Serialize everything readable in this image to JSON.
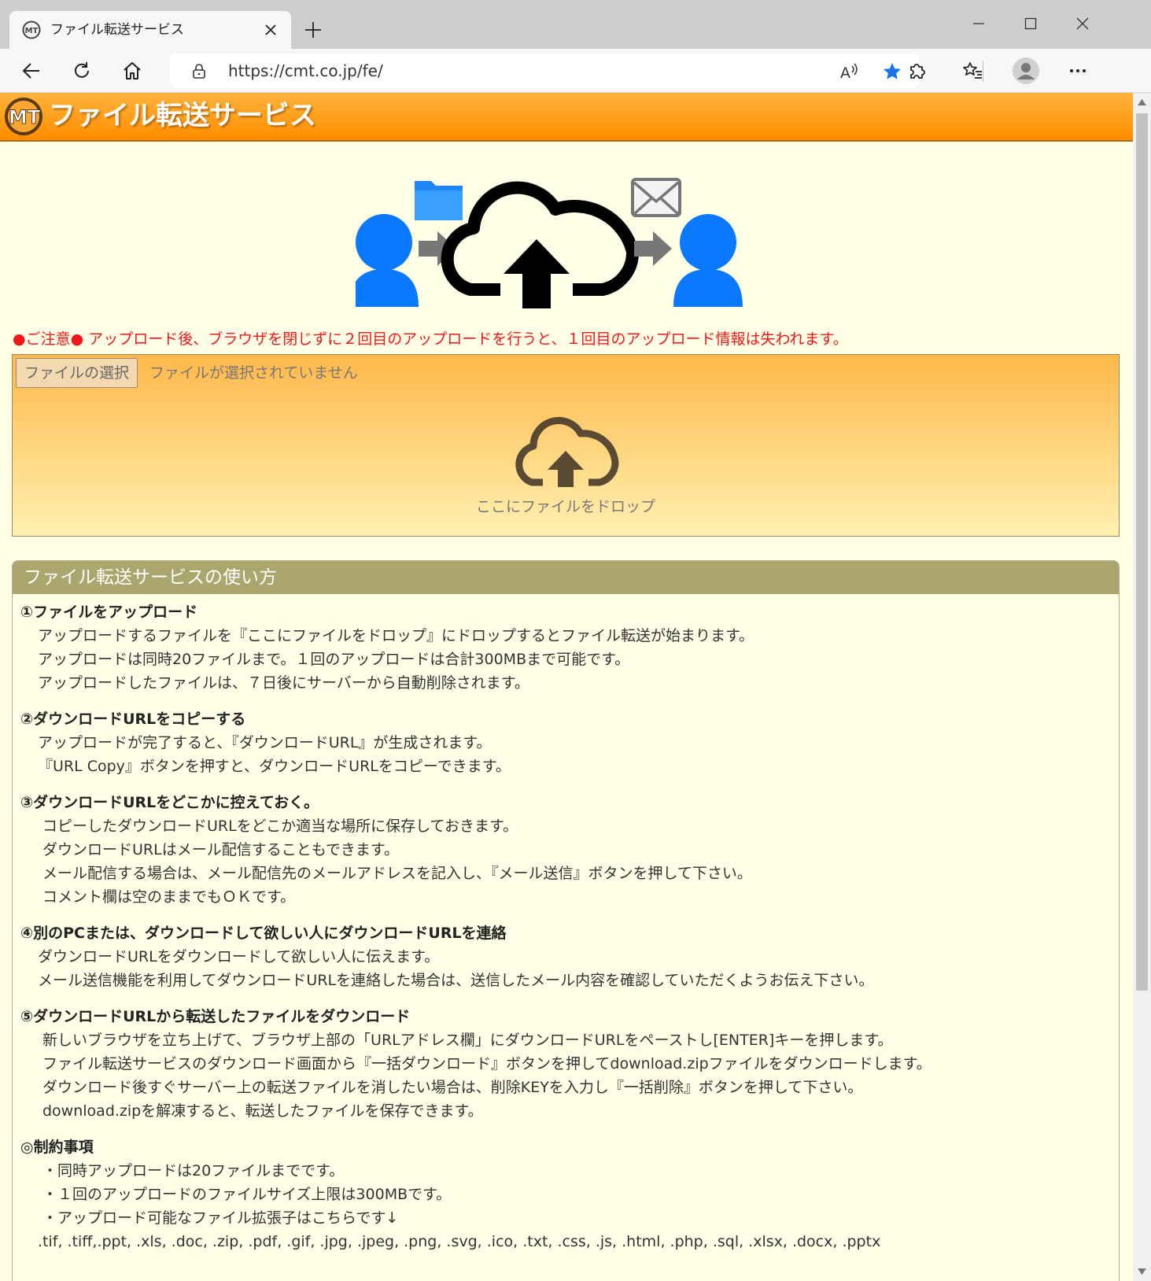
{
  "browser": {
    "tab_title": "ファイル転送サービス",
    "url": "https://cmt.co.jp/fe/"
  },
  "colors": {
    "header_orange": "#ff8c00",
    "page_background": "#ffffe8",
    "notice_red": "#f01818",
    "section_header": "#aaa66e",
    "person_blue": "#0a78ff"
  },
  "icons": [
    "cmt-logo-icon",
    "close-icon",
    "plus-icon",
    "minimize-icon",
    "maximize-icon",
    "back-icon",
    "refresh-icon",
    "home-icon",
    "lock-icon",
    "read-aloud-icon",
    "star-icon",
    "extensions-icon",
    "favorites-icon",
    "profile-icon",
    "more-icon",
    "cloud-upload-icon",
    "folder-icon",
    "mail-icon",
    "person-icon"
  ],
  "site": {
    "title": "ファイル転送サービス"
  },
  "notice": "●ご注意● アップロード後、ブラウザを閉じずに２回目のアップロードを行うと、１回目のアップロード情報は失われます。",
  "upload": {
    "button_label": "ファイルの選択",
    "status": "ファイルが選択されていません",
    "drop_label": "ここにファイルをドロップ"
  },
  "howto": {
    "title": "ファイル転送サービスの使い方",
    "steps": [
      {
        "title": "①ファイルをアップロード",
        "lines": [
          "アップロードするファイルを『ここにファイルをドロップ』にドロップするとファイル転送が始まります。",
          "アップロードは同時20ファイルまで。１回のアップロードは合計300MBまで可能です。",
          "アップロードしたファイルは、７日後にサーバーから自動削除されます。"
        ]
      },
      {
        "title": "②ダウンロードURLをコピーする",
        "lines": [
          "アップロードが完了すると、『ダウンロードURL』が生成されます。",
          "『URL Copy』ボタンを押すと、ダウンロードURLをコピーできます。"
        ]
      },
      {
        "title": "③ダウンロードURLをどこかに控えておく。",
        "lines": [
          "コピーしたダウンロードURLをどこか適当な場所に保存しておきます。",
          "ダウンロードURLはメール配信することもできます。",
          "メール配信する場合は、メール配信先のメールアドレスを記入し、『メール送信』ボタンを押して下さい。",
          "コメント欄は空のままでもＯＫです。"
        ]
      },
      {
        "title": "④別のPCまたは、ダウンロードして欲しい人にダウンロードURLを連絡",
        "lines": [
          "ダウンロードURLをダウンロードして欲しい人に伝えます。",
          "メール送信機能を利用してダウンロードURLを連絡した場合は、送信したメール内容を確認していただくようお伝え下さい。"
        ]
      },
      {
        "title": "⑤ダウンロードURLから転送したファイルをダウンロード",
        "lines": [
          "新しいブラウザを立ち上げて、ブラウザ上部の「URLアドレス欄」にダウンロードURLをペーストし[ENTER]キーを押します。",
          "ファイル転送サービスのダウンロード画面から『一括ダウンロード』ボタンを押してdownload.zipファイルをダウンロードします。",
          "ダウンロード後すぐサーバー上の転送ファイルを消したい場合は、削除KEYを入力し『一括削除』ボタンを押して下さい。",
          "download.zipを解凍すると、転送したファイルを保存できます。"
        ]
      }
    ],
    "restrictions": {
      "title": "◎制約事項",
      "lines": [
        "・同時アップロードは20ファイルまでです。",
        "・１回のアップロードのファイルサイズ上限は300MBです。",
        "・アップロード可能なファイル拡張子はこちらです↓"
      ],
      "extensions": ".tif, .tiff,.ppt, .xls, .doc, .zip, .pdf, .gif, .jpg, .jpeg, .png, .svg, .ico, .txt, .css, .js, .html, .php, .sql, .xlsx, .docx, .pptx"
    }
  }
}
